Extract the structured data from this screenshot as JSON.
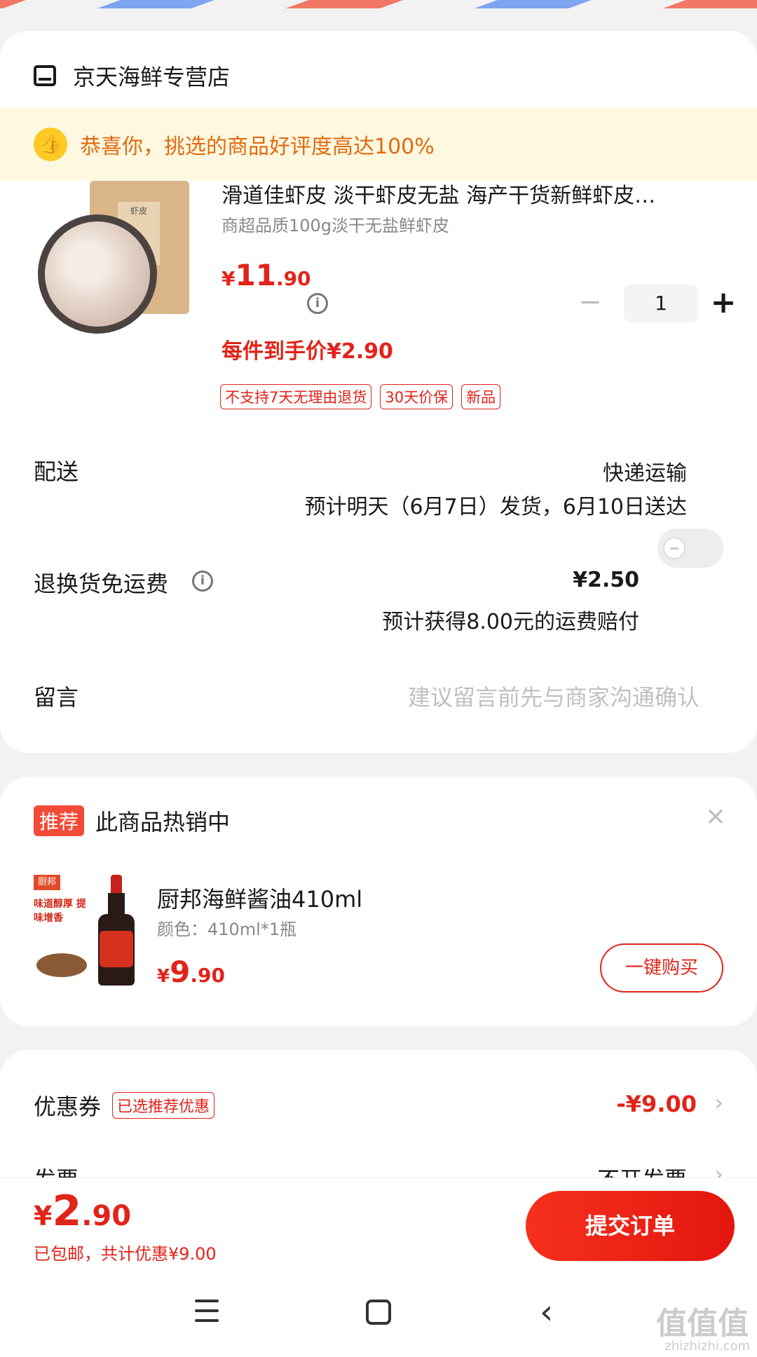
{
  "shop": {
    "name": "京天海鲜专营店"
  },
  "praise": {
    "text": "恭喜你，挑选的商品好评度高达100%"
  },
  "product": {
    "title": "滑道佳虾皮 淡干虾皮无盐 海产干货新鲜虾皮…",
    "spec": "商超品质100g淡干无盐鲜虾皮",
    "price_currency": "¥",
    "price_int": "11",
    "price_dec": ".90",
    "hand_price": "每件到手价¥2.90",
    "tags": [
      "不支持7天无理由退货",
      "30天价保",
      "新品"
    ],
    "quantity": "1",
    "minus": "−",
    "plus": "+",
    "image_label": "虾皮"
  },
  "delivery": {
    "label": "配送",
    "method": "快递运输",
    "eta": "预计明天（6月7日）发货，6月10日送达"
  },
  "return_shipping": {
    "label": "退换货免运费",
    "price": "¥2.50",
    "note": "预计获得8.00元的运费赔付",
    "enabled": false
  },
  "message": {
    "label": "留言",
    "placeholder": "建议留言前先与商家沟通确认"
  },
  "recommend": {
    "tag": "推荐",
    "title": "此商品热销中",
    "close": "×",
    "name": "厨邦海鲜酱油410ml",
    "spec": "颜色：410ml*1瓶",
    "price_currency": "¥",
    "price_int": "9",
    "price_dec": ".90",
    "buy_label": "一键购买",
    "image_brand": "厨邦",
    "image_slogan": "味道醇厚 提味增香"
  },
  "coupon": {
    "label": "优惠券",
    "tag": "已选推荐优惠",
    "value": "-¥9.00"
  },
  "invoice": {
    "label": "发票",
    "value": "不开发票"
  },
  "bottom": {
    "total_currency": "¥",
    "total_int": "2",
    "total_dec": ".90",
    "note": "已包邮，共计优惠¥9.00",
    "submit_label": "提交订单"
  },
  "watermark": {
    "text": "值值值",
    "url": "zhizhizhi.com"
  },
  "colors": {
    "accent": "#e2231a",
    "praise_bg": "#fff8e0",
    "praise_text": "#e06a10",
    "thumb": "#fec925"
  }
}
